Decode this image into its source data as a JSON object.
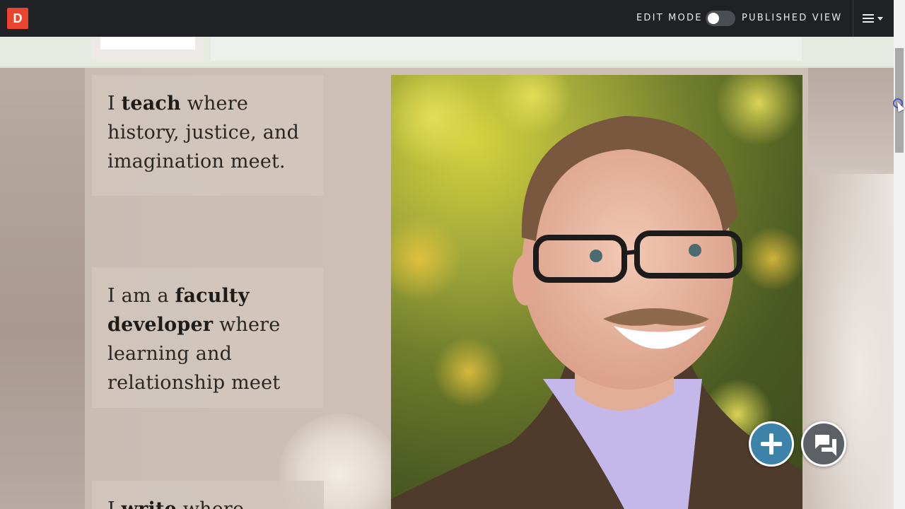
{
  "topbar": {
    "logo_text": "D",
    "edit_mode_label": "EDIT MODE",
    "published_view_label": "PUBLISHED VIEW",
    "toggle_state": "off",
    "menu_icon": "hamburger-icon"
  },
  "cards": [
    {
      "prefix": "I ",
      "bold": "teach",
      "rest": " where history, justice, and imagination meet."
    },
    {
      "prefix": "I am a ",
      "bold": "faculty developer",
      "rest": " where learning and relationship meet"
    },
    {
      "prefix": "I ",
      "bold": "write",
      "rest": " where"
    }
  ],
  "actions": {
    "add_icon": "plus-icon",
    "comments_icon": "chat-bubbles-icon"
  },
  "colors": {
    "topbar_bg": "#1f2125",
    "logo_bg": "#e8442e",
    "add_button_bg": "#3d82a8",
    "chat_button_bg": "#5d6065"
  }
}
